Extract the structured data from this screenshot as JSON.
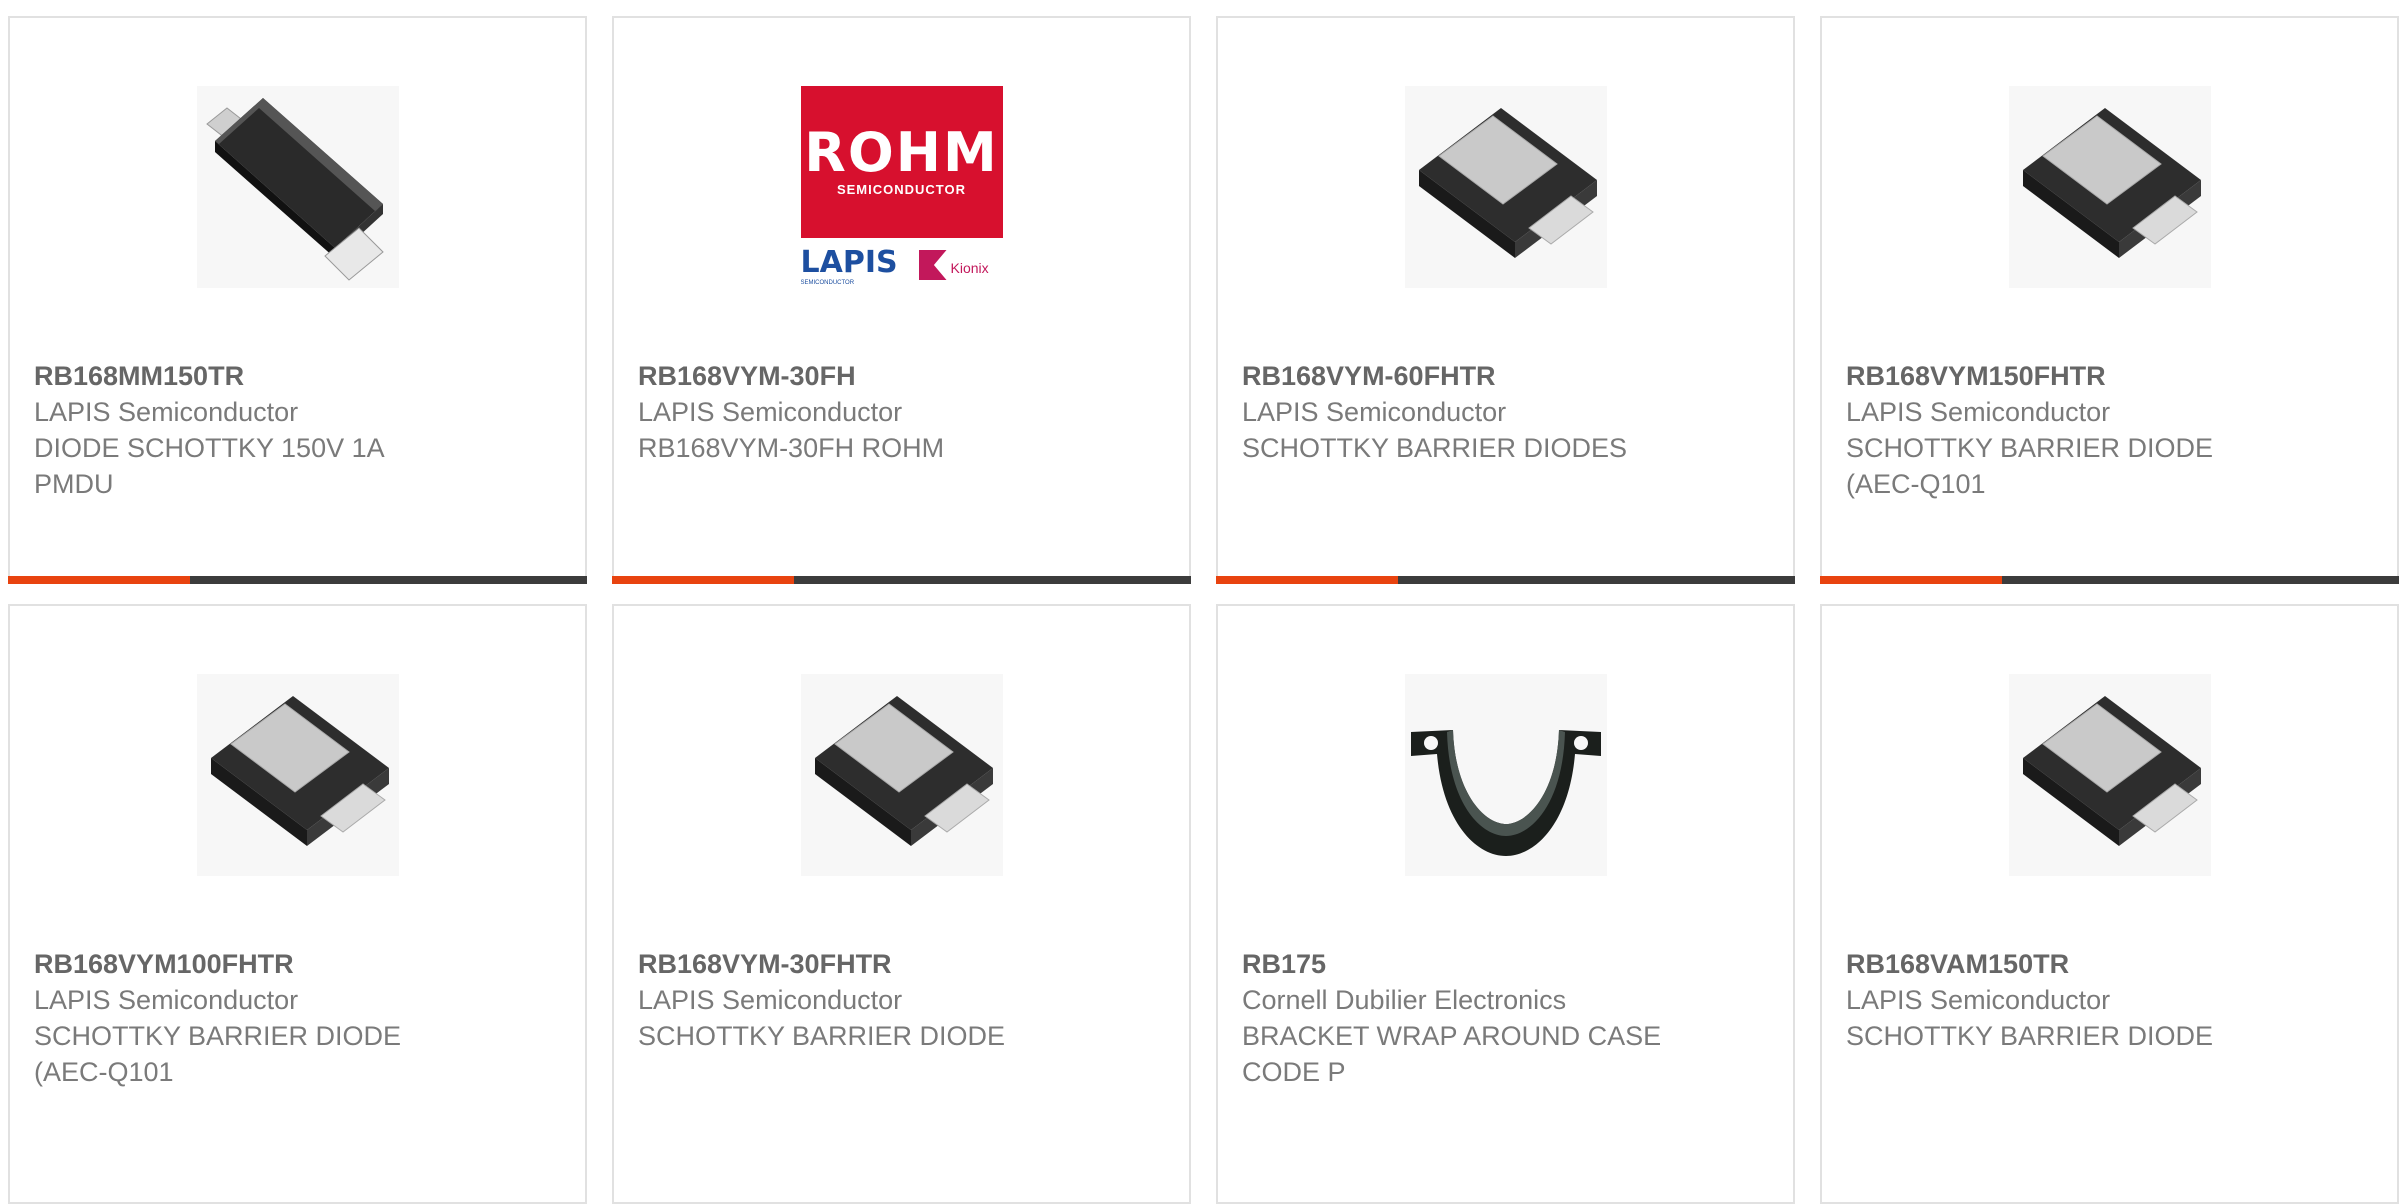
{
  "colors": {
    "accent": "#e8430f",
    "bar": "#3c3c3c",
    "border": "#e1e1e1",
    "text": "#7a7a7a"
  },
  "products": [
    {
      "pn": "RB168MM150TR",
      "mfr": "LAPIS Semiconductor",
      "desc": "DIODE SCHOTTKY 150V 1A PMDU",
      "image": "diode-pmdu-image"
    },
    {
      "pn": "RB168VYM-30FH",
      "mfr": "LAPIS Semiconductor",
      "desc": "RB168VYM-30FH ROHM",
      "image": "rohm-lapis-kionix-logo",
      "logo": {
        "brand": "ROHM",
        "sub": "SEMICONDUCTOR",
        "lapis": "LAPIS",
        "lapis_sub": "SEMICONDUCTOR",
        "kionix": "Kionix"
      }
    },
    {
      "pn": "RB168VYM-60FHTR",
      "mfr": "LAPIS Semiconductor",
      "desc": "SCHOTTKY BARRIER DIODES",
      "image": "diode-smd-image"
    },
    {
      "pn": "RB168VYM150FHTR",
      "mfr": "LAPIS Semiconductor",
      "desc": "SCHOTTKY BARRIER DIODE (AEC-Q101",
      "image": "diode-smd-image"
    },
    {
      "pn": "RB168VYM100FHTR",
      "mfr": "LAPIS Semiconductor",
      "desc": "SCHOTTKY BARRIER DIODE (AEC-Q101",
      "image": "diode-smd-image"
    },
    {
      "pn": "RB168VYM-30FHTR",
      "mfr": "LAPIS Semiconductor",
      "desc": "SCHOTTKY BARRIER DIODE",
      "image": "diode-smd-image"
    },
    {
      "pn": "RB175",
      "mfr": "Cornell Dubilier Electronics",
      "desc": "BRACKET WRAP AROUND CASE CODE P",
      "image": "bracket-image"
    },
    {
      "pn": "RB168VAM150TR",
      "mfr": "LAPIS Semiconductor",
      "desc": "SCHOTTKY BARRIER DIODE",
      "image": "diode-smd-image"
    }
  ]
}
